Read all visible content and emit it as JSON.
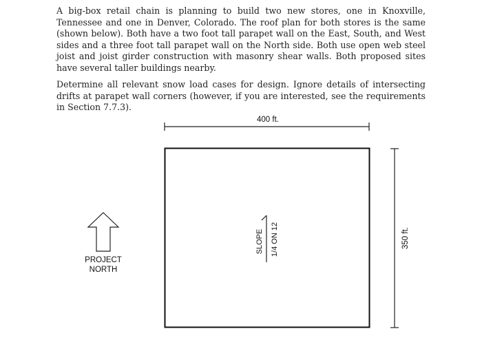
{
  "problem": {
    "paragraph1": "A big-box retail chain is planning to build two new stores, one in Knoxville, Tennessee and one in Denver, Colorado. The roof plan for both stores is the same (shown below). Both have a two foot tall parapet wall on the East, South, and West sides and a three foot tall parapet wall on the North side. Both use open web steel joist and joist girder construction with masonry shear walls. Both proposed sites have several taller buildings nearby.",
    "paragraph2": "Determine all relevant snow load cases for design. Ignore details of intersecting drifts at parapet wall corners (however, if you are interested, see the requirements in Section 7.7.3)."
  },
  "roof_plan": {
    "width_label": "400 ft.",
    "height_label": "350 ft.",
    "slope_label": "SLOPE",
    "slope_value": "1/4 ON 12",
    "north_label_line1": "PROJECT",
    "north_label_line2": "NORTH",
    "north_icon": "up-arrow-outline"
  }
}
